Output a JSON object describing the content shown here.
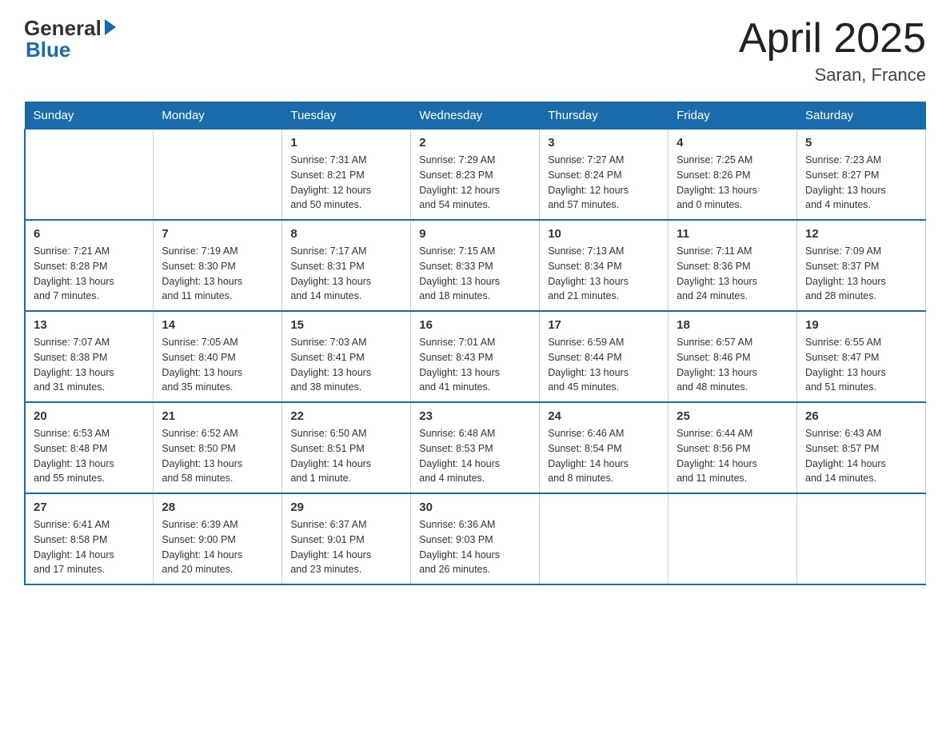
{
  "header": {
    "logo_general": "General",
    "logo_blue": "Blue",
    "title": "April 2025",
    "location": "Saran, France"
  },
  "days_of_week": [
    "Sunday",
    "Monday",
    "Tuesday",
    "Wednesday",
    "Thursday",
    "Friday",
    "Saturday"
  ],
  "weeks": [
    [
      {
        "day": "",
        "info": ""
      },
      {
        "day": "",
        "info": ""
      },
      {
        "day": "1",
        "info": "Sunrise: 7:31 AM\nSunset: 8:21 PM\nDaylight: 12 hours\nand 50 minutes."
      },
      {
        "day": "2",
        "info": "Sunrise: 7:29 AM\nSunset: 8:23 PM\nDaylight: 12 hours\nand 54 minutes."
      },
      {
        "day": "3",
        "info": "Sunrise: 7:27 AM\nSunset: 8:24 PM\nDaylight: 12 hours\nand 57 minutes."
      },
      {
        "day": "4",
        "info": "Sunrise: 7:25 AM\nSunset: 8:26 PM\nDaylight: 13 hours\nand 0 minutes."
      },
      {
        "day": "5",
        "info": "Sunrise: 7:23 AM\nSunset: 8:27 PM\nDaylight: 13 hours\nand 4 minutes."
      }
    ],
    [
      {
        "day": "6",
        "info": "Sunrise: 7:21 AM\nSunset: 8:28 PM\nDaylight: 13 hours\nand 7 minutes."
      },
      {
        "day": "7",
        "info": "Sunrise: 7:19 AM\nSunset: 8:30 PM\nDaylight: 13 hours\nand 11 minutes."
      },
      {
        "day": "8",
        "info": "Sunrise: 7:17 AM\nSunset: 8:31 PM\nDaylight: 13 hours\nand 14 minutes."
      },
      {
        "day": "9",
        "info": "Sunrise: 7:15 AM\nSunset: 8:33 PM\nDaylight: 13 hours\nand 18 minutes."
      },
      {
        "day": "10",
        "info": "Sunrise: 7:13 AM\nSunset: 8:34 PM\nDaylight: 13 hours\nand 21 minutes."
      },
      {
        "day": "11",
        "info": "Sunrise: 7:11 AM\nSunset: 8:36 PM\nDaylight: 13 hours\nand 24 minutes."
      },
      {
        "day": "12",
        "info": "Sunrise: 7:09 AM\nSunset: 8:37 PM\nDaylight: 13 hours\nand 28 minutes."
      }
    ],
    [
      {
        "day": "13",
        "info": "Sunrise: 7:07 AM\nSunset: 8:38 PM\nDaylight: 13 hours\nand 31 minutes."
      },
      {
        "day": "14",
        "info": "Sunrise: 7:05 AM\nSunset: 8:40 PM\nDaylight: 13 hours\nand 35 minutes."
      },
      {
        "day": "15",
        "info": "Sunrise: 7:03 AM\nSunset: 8:41 PM\nDaylight: 13 hours\nand 38 minutes."
      },
      {
        "day": "16",
        "info": "Sunrise: 7:01 AM\nSunset: 8:43 PM\nDaylight: 13 hours\nand 41 minutes."
      },
      {
        "day": "17",
        "info": "Sunrise: 6:59 AM\nSunset: 8:44 PM\nDaylight: 13 hours\nand 45 minutes."
      },
      {
        "day": "18",
        "info": "Sunrise: 6:57 AM\nSunset: 8:46 PM\nDaylight: 13 hours\nand 48 minutes."
      },
      {
        "day": "19",
        "info": "Sunrise: 6:55 AM\nSunset: 8:47 PM\nDaylight: 13 hours\nand 51 minutes."
      }
    ],
    [
      {
        "day": "20",
        "info": "Sunrise: 6:53 AM\nSunset: 8:48 PM\nDaylight: 13 hours\nand 55 minutes."
      },
      {
        "day": "21",
        "info": "Sunrise: 6:52 AM\nSunset: 8:50 PM\nDaylight: 13 hours\nand 58 minutes."
      },
      {
        "day": "22",
        "info": "Sunrise: 6:50 AM\nSunset: 8:51 PM\nDaylight: 14 hours\nand 1 minute."
      },
      {
        "day": "23",
        "info": "Sunrise: 6:48 AM\nSunset: 8:53 PM\nDaylight: 14 hours\nand 4 minutes."
      },
      {
        "day": "24",
        "info": "Sunrise: 6:46 AM\nSunset: 8:54 PM\nDaylight: 14 hours\nand 8 minutes."
      },
      {
        "day": "25",
        "info": "Sunrise: 6:44 AM\nSunset: 8:56 PM\nDaylight: 14 hours\nand 11 minutes."
      },
      {
        "day": "26",
        "info": "Sunrise: 6:43 AM\nSunset: 8:57 PM\nDaylight: 14 hours\nand 14 minutes."
      }
    ],
    [
      {
        "day": "27",
        "info": "Sunrise: 6:41 AM\nSunset: 8:58 PM\nDaylight: 14 hours\nand 17 minutes."
      },
      {
        "day": "28",
        "info": "Sunrise: 6:39 AM\nSunset: 9:00 PM\nDaylight: 14 hours\nand 20 minutes."
      },
      {
        "day": "29",
        "info": "Sunrise: 6:37 AM\nSunset: 9:01 PM\nDaylight: 14 hours\nand 23 minutes."
      },
      {
        "day": "30",
        "info": "Sunrise: 6:36 AM\nSunset: 9:03 PM\nDaylight: 14 hours\nand 26 minutes."
      },
      {
        "day": "",
        "info": ""
      },
      {
        "day": "",
        "info": ""
      },
      {
        "day": "",
        "info": ""
      }
    ]
  ]
}
